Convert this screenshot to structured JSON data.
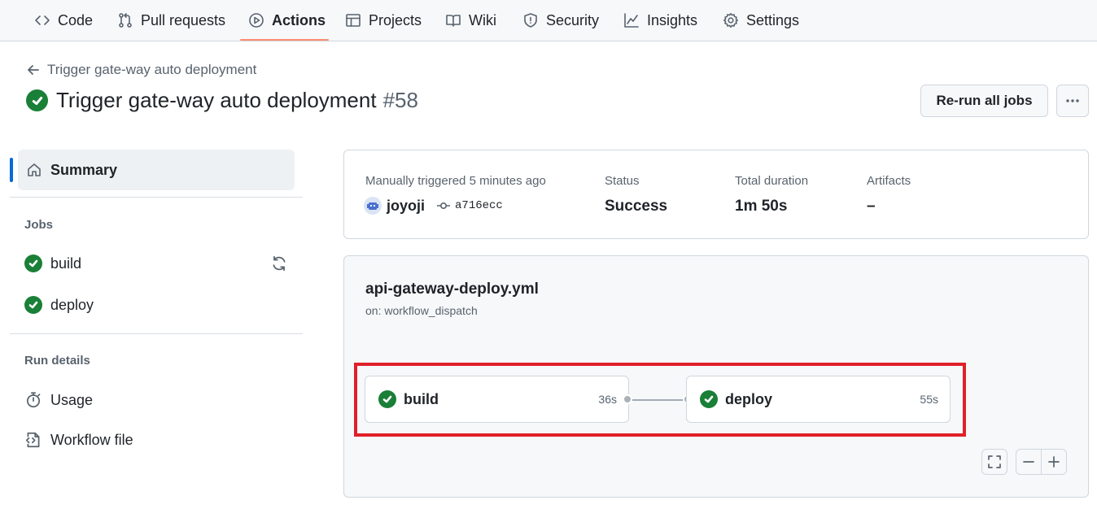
{
  "nav": {
    "tabs": [
      {
        "label": "Code",
        "icon": "code-icon"
      },
      {
        "label": "Pull requests",
        "icon": "pull-request-icon"
      },
      {
        "label": "Actions",
        "icon": "play-icon",
        "active": true
      },
      {
        "label": "Projects",
        "icon": "table-icon"
      },
      {
        "label": "Wiki",
        "icon": "book-icon"
      },
      {
        "label": "Security",
        "icon": "shield-icon"
      },
      {
        "label": "Insights",
        "icon": "graph-icon"
      },
      {
        "label": "Settings",
        "icon": "gear-icon"
      }
    ]
  },
  "header": {
    "back_label": "Trigger gate-way auto deployment",
    "title": "Trigger gate-way auto deployment",
    "run_number": "#58",
    "rerun_label": "Re-run all jobs"
  },
  "sidebar": {
    "summary_label": "Summary",
    "jobs_heading": "Jobs",
    "jobs": [
      {
        "label": "build",
        "status": "success"
      },
      {
        "label": "deploy",
        "status": "success"
      }
    ],
    "run_details_heading": "Run details",
    "details": [
      {
        "label": "Usage",
        "icon": "stopwatch-icon"
      },
      {
        "label": "Workflow file",
        "icon": "file-code-icon"
      }
    ]
  },
  "summary": {
    "trigger_label": "Manually triggered 5 minutes ago",
    "actor": "joyoji",
    "commit": "a716ecc",
    "status_label": "Status",
    "status_value": "Success",
    "duration_label": "Total duration",
    "duration_value": "1m 50s",
    "artifacts_label": "Artifacts",
    "artifacts_value": "–"
  },
  "workflow": {
    "file": "api-gateway-deploy.yml",
    "trigger": "on: workflow_dispatch",
    "jobs": [
      {
        "name": "build",
        "duration": "36s"
      },
      {
        "name": "deploy",
        "duration": "55s"
      }
    ]
  },
  "colors": {
    "success": "#1a7f37",
    "active_tab_underline": "#fd8c73",
    "highlight": "#e0202a",
    "accent": "#0969da"
  }
}
